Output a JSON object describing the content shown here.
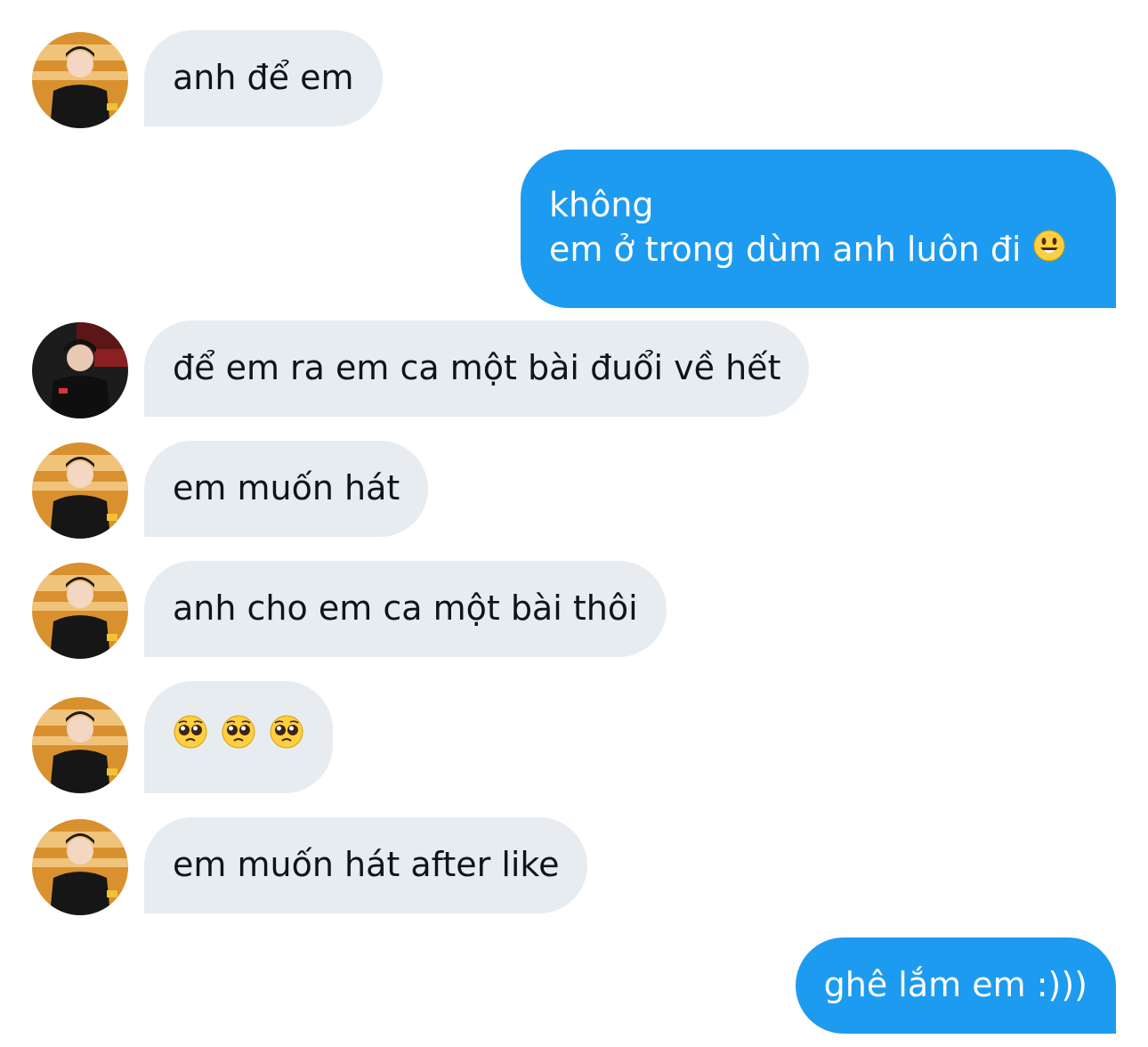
{
  "messages": [
    {
      "side": "in",
      "avatar": "player-avatar-yellow",
      "text": "anh để em"
    },
    {
      "side": "out",
      "lines": [
        "không",
        "em ở trong dùm anh luôn đi"
      ],
      "trailing_emoji": "smiley-emoji"
    },
    {
      "side": "in",
      "avatar": "player-avatar-red",
      "text": "để em ra em ca một bài đuổi về hết"
    },
    {
      "side": "in",
      "avatar": "player-avatar-yellow",
      "text": "em muốn hát"
    },
    {
      "side": "in",
      "avatar": "player-avatar-yellow",
      "text": "anh cho em ca một bài thôi"
    },
    {
      "side": "in",
      "avatar": "player-avatar-yellow",
      "emojis": [
        "pleading-face-emoji",
        "pleading-face-emoji",
        "pleading-face-emoji"
      ]
    },
    {
      "side": "in",
      "avatar": "player-avatar-yellow",
      "text": "em muốn hát after like"
    },
    {
      "side": "out",
      "text": "ghê lắm em :)))"
    }
  ],
  "colors": {
    "incoming_bubble": "#e7ecf0",
    "outgoing_bubble": "#1d9bf0",
    "incoming_text": "#0f1419",
    "outgoing_text": "#ffffff"
  }
}
